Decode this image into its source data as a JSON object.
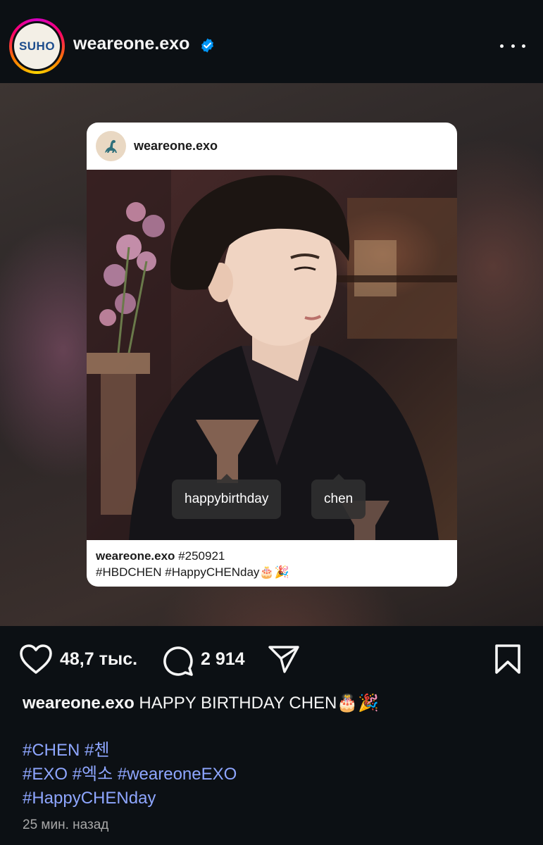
{
  "header": {
    "avatar_text": "SUHO",
    "username": "weareone.exo",
    "verified_icon": "verified-badge-icon",
    "more_icon": "more-options-icon"
  },
  "shared_post": {
    "username": "weareone.exo",
    "avatar_icon": "dinosaur-icon",
    "tags": [
      "happybirthday",
      "chen"
    ],
    "caption_user": "weareone.exo",
    "caption_line1": " #250921",
    "caption_line2": "#HBDCHEN #HappyCHENday🎂🎉"
  },
  "actions": {
    "like_icon": "heart-icon",
    "likes": "48,7 тыс.",
    "comment_icon": "comment-icon",
    "comments": "2 914",
    "share_icon": "send-icon",
    "save_icon": "bookmark-icon"
  },
  "caption": {
    "username": "weareone.exo",
    "text": " HAPPY BIRTHDAY CHEN🎂🎉",
    "hashtag_lines": [
      "#CHEN #첸",
      "#EXO #엑소 #weareoneEXO",
      "#HappyCHENday"
    ]
  },
  "timestamp": "25 мин. назад",
  "colors": {
    "background": "#0c1014",
    "hashtag": "#8ea6ff",
    "verified": "#0095f6"
  }
}
